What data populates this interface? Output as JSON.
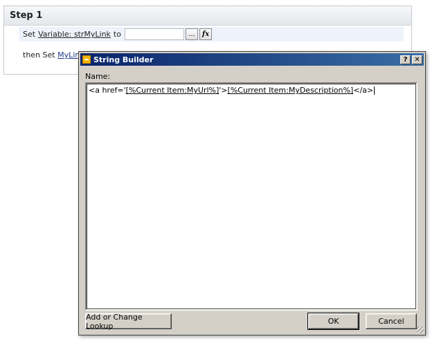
{
  "step": {
    "title": "Step 1",
    "row1": {
      "prefix": "Set",
      "variable_link": "Variable: strMyLink",
      "connector": "to",
      "value": "",
      "builder_button": "...",
      "fx_button": "fx"
    },
    "row2": {
      "prefix": "then Set",
      "link_partial": "MyLin"
    }
  },
  "dialog": {
    "title": "String Builder",
    "help_button": "?",
    "close_button": "✕",
    "name_label": "Name:",
    "content": {
      "part1": "<a href='",
      "lookup1": "[%Current Item:MyUrl%]",
      "part2": "'>",
      "lookup2": "[%Current Item:MyDescription%]",
      "part3": "</a>"
    },
    "add_lookup_button": "Add or Change Lookup",
    "ok_button": "OK",
    "cancel_button": "Cancel"
  },
  "colors": {
    "titlebar_start": "#0a246a",
    "titlebar_end": "#3a6ea5",
    "dialog_face": "#d4d0c8",
    "link": "#1f3a8a"
  }
}
